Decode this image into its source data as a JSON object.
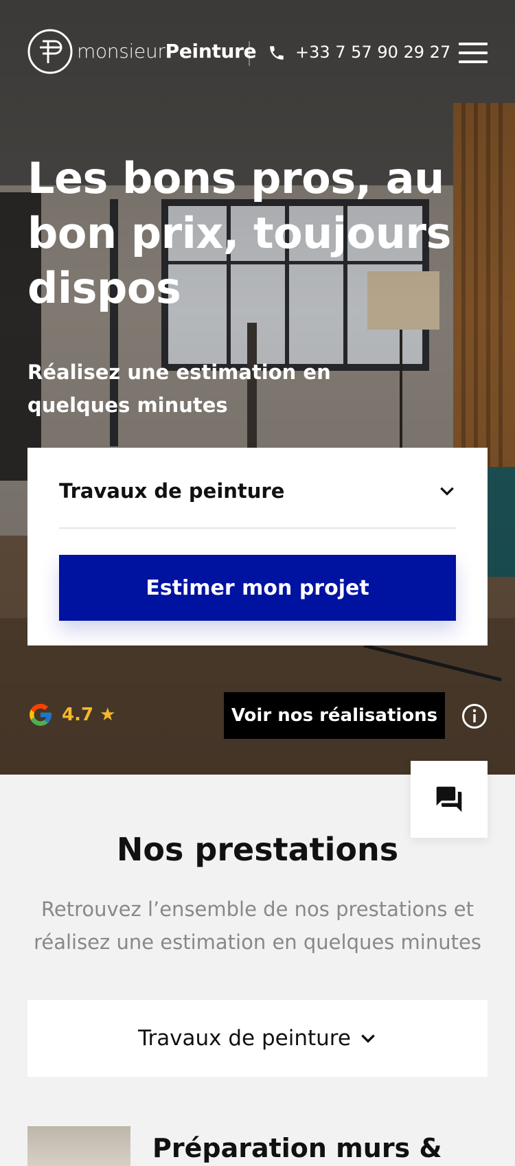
{
  "header": {
    "logo_light": "monsieur",
    "logo_bold": "Peinture",
    "phone": "+33 7 57 90 29 27"
  },
  "hero": {
    "headline": "Les bons pros, au bon prix, toujours dispos",
    "subline": "Réalisez une estimation en quelques minutes",
    "select_value": "Travaux de peinture",
    "cta_label": "Estimer mon projet",
    "rating": "4.7 ★",
    "realisations_label": "Voir nos réalisations"
  },
  "services": {
    "title": "Nos prestations",
    "subtitle": "Retrouvez l’ensemble de nos prestations et réalisez une estimation en quelques minutes",
    "category": "Travaux de peinture",
    "first_item": "Préparation murs &"
  },
  "colors": {
    "primary": "#0012a0",
    "rating": "#f5b82a",
    "button_dark": "#000000"
  },
  "icons": [
    "logo-mark",
    "phone-icon",
    "menu-icon",
    "chevron-down-icon",
    "google-icon",
    "info-icon",
    "chat-icon"
  ]
}
